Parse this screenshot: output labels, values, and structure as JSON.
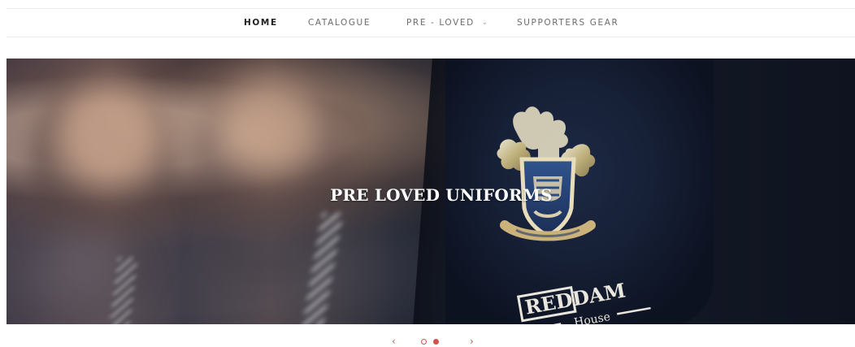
{
  "navigation": {
    "items": [
      {
        "label": "HOME"
      },
      {
        "label": "CATALOGUE"
      },
      {
        "label": "PRE - LOVED"
      },
      {
        "label": "SUPPORTERS GEAR"
      }
    ]
  },
  "hero": {
    "title": "PRE LOVED UNIFORMS",
    "badge_text": "REDDAM",
    "badge_subtext": "House"
  },
  "carousel": {
    "prev": "‹",
    "next": "›"
  },
  "colors": {
    "accent": "#d6504d",
    "nav_text": "#6c6c6c",
    "nav_active": "#222222"
  },
  "icons": {
    "dropdown": "chevron-down-icon",
    "previous": "chevron-left-icon",
    "next": "chevron-right-icon"
  }
}
